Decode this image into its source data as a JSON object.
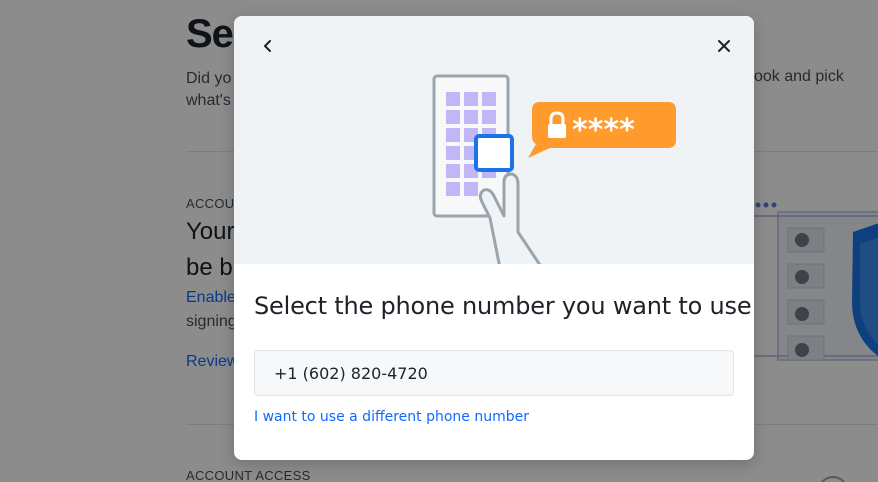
{
  "background": {
    "title": "Sec",
    "desc_left": "Did yo",
    "desc_left_line2": "what's",
    "desc_right": "ook and pick",
    "section1_label": "ACCOU",
    "section1_heading_l1": "Your",
    "section1_heading_l2": "be b",
    "enable_link": "Enable",
    "signing_text": "signing",
    "review_link": "Review",
    "section2_label": "ACCOUNT ACCESS"
  },
  "modal": {
    "title": "Select the phone number you want to use",
    "phone_option": "+1 (602) 820-4720",
    "different_number_link": "I want to use a different phone number",
    "illustration_code": "****",
    "back_icon": "chevron-left-icon",
    "close_icon": "close-icon"
  },
  "colors": {
    "accent": "#0f69ff",
    "bubble": "#ff9b2d",
    "keypad": "#c3b6f7",
    "hero_bg": "#f0f3f5"
  }
}
